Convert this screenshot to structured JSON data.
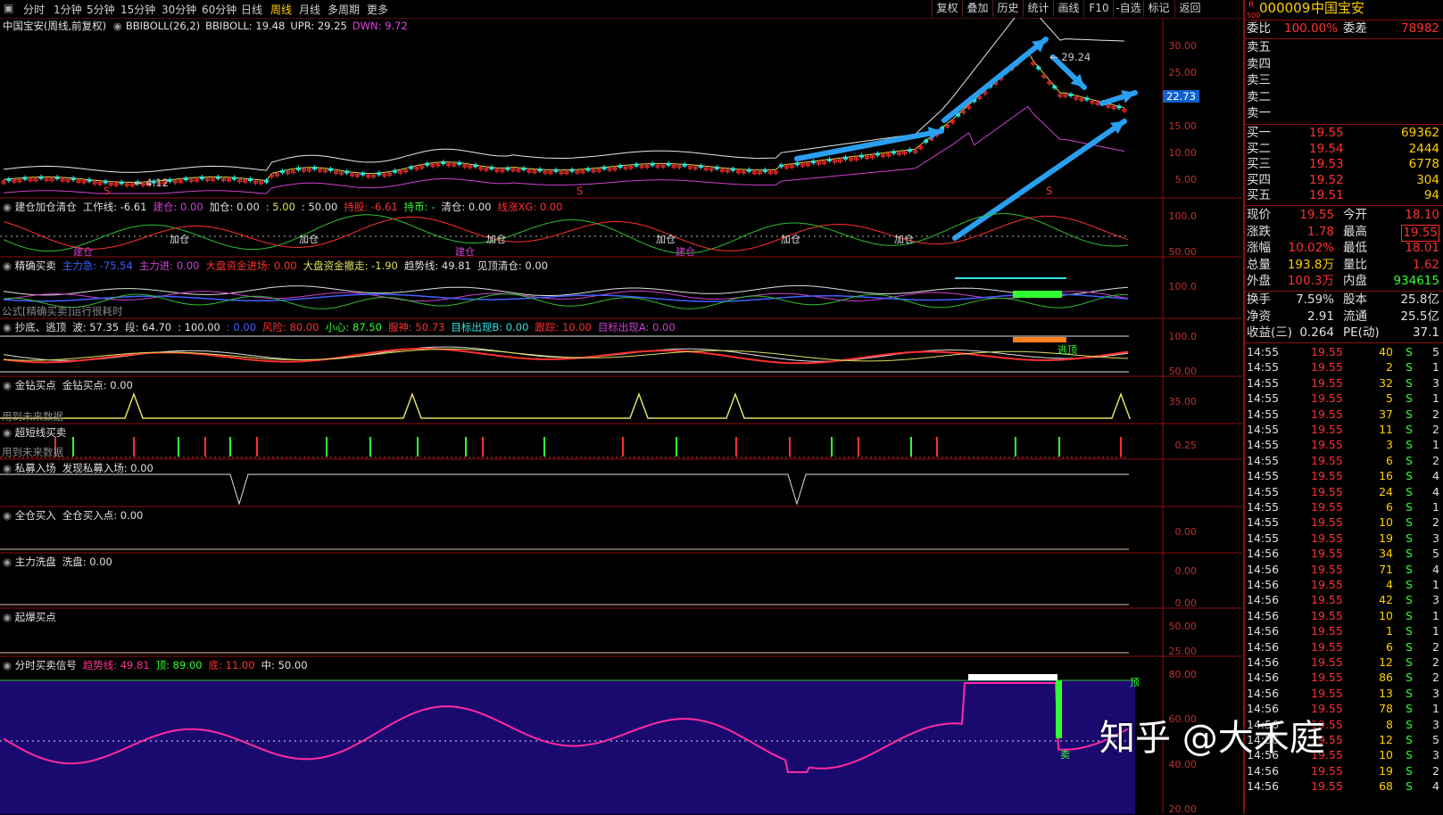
{
  "toolbar": {
    "tabs": [
      "分时",
      "1分钟",
      "5分钟",
      "15分钟",
      "30分钟",
      "60分钟",
      "日线",
      "周线",
      "月线",
      "多周期",
      "更多"
    ],
    "active_tab": "周线",
    "right_buttons": [
      "复权",
      "叠加",
      "历史",
      "统计",
      "画线",
      "F10",
      "-自选",
      "标记",
      "返回"
    ]
  },
  "main_panel": {
    "title": "中国宝安(周线,前复权)",
    "indicator": "BBIBOLL(26,2)",
    "bbiboll": "BBIBOLL: 19.48",
    "upr": "UPR: 29.25",
    "dwn": "DWN: 9.72",
    "high_mark": "29.24",
    "low_mark": "4.12",
    "price_tag": "22.73",
    "axis": [
      "30.00",
      "25.00",
      "20.00",
      "15.00",
      "10.00",
      "5.00"
    ],
    "s_marks": [
      "S",
      "S",
      "S"
    ]
  },
  "panels": [
    {
      "title": "建仓加仓清仓",
      "items": [
        "工作线: -6.61",
        "建仓: 0.00",
        "加仓: 0.00",
        ": 5.00",
        ": 50.00",
        "持股: -6.61",
        "持币: -",
        "清仓: 0.00",
        "线涨XG: 0.00"
      ],
      "axis": [
        "100.0",
        "50.00"
      ],
      "marks": [
        "建仓",
        "加仓",
        "加仓",
        "建仓",
        "加仓",
        "建仓",
        "加仓",
        "加仓",
        "加仓"
      ]
    },
    {
      "title": "精确买卖",
      "items": [
        "主力急: -75.54",
        "主力进: 0.00",
        "大盘资金进场: 0.00",
        "大盘资金撤走: -1.90",
        "趋势线: 49.81",
        "见顶清仓: 0.00"
      ],
      "axis": [
        "100.0"
      ],
      "note": "公式[精确买卖]运行很耗时"
    },
    {
      "title": "抄底、逃顶",
      "items": [
        "波: 57.35",
        "段: 64.70",
        ": 100.00",
        ": 0.00",
        "风险: 80.00",
        "小心: 87.50",
        "服神: 50.73",
        "目标出现B: 0.00",
        "跟踪: 10.00",
        "目标出现A: 0.00"
      ],
      "axis": [
        "100.0",
        "50.00"
      ],
      "mark": "逃顶"
    },
    {
      "title": "金钻买点",
      "items": [
        "金钻买点: 0.00"
      ],
      "axis": [
        "35.00"
      ],
      "note": "用到未来数据"
    },
    {
      "title": "超短线买卖",
      "items": [],
      "axis": [
        "0.25"
      ],
      "note": "用到未来数据"
    },
    {
      "title": "私募入场",
      "items": [
        "发现私募入场: 0.00"
      ],
      "axis": []
    },
    {
      "title": "全仓买入",
      "items": [
        "全仓买入点: 0.00"
      ],
      "axis": [
        "0.00"
      ]
    },
    {
      "title": "主力洗盘",
      "items": [
        "洗盘: 0.00"
      ],
      "axis": [
        "0.00",
        "0.00"
      ]
    },
    {
      "title": "起爆买点",
      "items": [],
      "axis": [
        "50.00",
        "25.00"
      ]
    },
    {
      "title": "分时买卖信号",
      "items": [
        "趋势线: 49.81",
        "顶: 89.00",
        "底: 11.00",
        "中: 50.00"
      ],
      "axis": [
        "80.00",
        "60.00",
        "40.00",
        "20.00"
      ],
      "marks": [
        "顶",
        "卖"
      ]
    }
  ],
  "quote": {
    "code": "000009",
    "name": "中国宝安",
    "r_label": "R",
    "r_num": "500",
    "weibi_label": "委比",
    "weibi": "100.00%",
    "weicha_label": "委差",
    "weicha": "78982",
    "asks": [
      "卖五",
      "卖四",
      "卖三",
      "卖二",
      "卖一"
    ],
    "bids": [
      {
        "label": "买一",
        "price": "19.55",
        "vol": "69362"
      },
      {
        "label": "买二",
        "price": "19.54",
        "vol": "2444"
      },
      {
        "label": "买三",
        "price": "19.53",
        "vol": "6778"
      },
      {
        "label": "买四",
        "price": "19.52",
        "vol": "304"
      },
      {
        "label": "买五",
        "price": "19.51",
        "vol": "94"
      }
    ],
    "stats": [
      {
        "l1": "现价",
        "v1": "19.55",
        "l2": "今开",
        "v2": "18.10"
      },
      {
        "l1": "涨跌",
        "v1": "1.78",
        "l2": "最高",
        "v2": "19.55"
      },
      {
        "l1": "涨幅",
        "v1": "10.02%",
        "l2": "最低",
        "v2": "18.01"
      },
      {
        "l1": "总量",
        "v1": "193.8万",
        "l2": "量比",
        "v2": "1.62"
      },
      {
        "l1": "外盘",
        "v1": "100.3万",
        "l2": "内盘",
        "v2": "934615"
      }
    ],
    "stats2": [
      {
        "l1": "换手",
        "v1": "7.59%",
        "l2": "股本",
        "v2": "25.8亿"
      },
      {
        "l1": "净资",
        "v1": "2.91",
        "l2": "流通",
        "v2": "25.5亿"
      },
      {
        "l1": "收益(三)",
        "v1": "0.264",
        "l2": "PE(动)",
        "v2": "37.1"
      }
    ],
    "ticks": [
      [
        "14:55",
        "19.55",
        "40",
        "S",
        "5"
      ],
      [
        "14:55",
        "19.55",
        "2",
        "S",
        "1"
      ],
      [
        "14:55",
        "19.55",
        "32",
        "S",
        "3"
      ],
      [
        "14:55",
        "19.55",
        "5",
        "S",
        "1"
      ],
      [
        "14:55",
        "19.55",
        "37",
        "S",
        "2"
      ],
      [
        "14:55",
        "19.55",
        "11",
        "S",
        "2"
      ],
      [
        "14:55",
        "19.55",
        "3",
        "S",
        "1"
      ],
      [
        "14:55",
        "19.55",
        "6",
        "S",
        "2"
      ],
      [
        "14:55",
        "19.55",
        "16",
        "S",
        "4"
      ],
      [
        "14:55",
        "19.55",
        "24",
        "S",
        "4"
      ],
      [
        "14:55",
        "19.55",
        "6",
        "S",
        "1"
      ],
      [
        "14:55",
        "19.55",
        "10",
        "S",
        "2"
      ],
      [
        "14:55",
        "19.55",
        "19",
        "S",
        "3"
      ],
      [
        "14:56",
        "19.55",
        "34",
        "S",
        "5"
      ],
      [
        "14:56",
        "19.55",
        "71",
        "S",
        "4"
      ],
      [
        "14:56",
        "19.55",
        "4",
        "S",
        "1"
      ],
      [
        "14:56",
        "19.55",
        "42",
        "S",
        "3"
      ],
      [
        "14:56",
        "19.55",
        "10",
        "S",
        "1"
      ],
      [
        "14:56",
        "19.55",
        "1",
        "S",
        "1"
      ],
      [
        "14:56",
        "19.55",
        "6",
        "S",
        "2"
      ],
      [
        "14:56",
        "19.55",
        "12",
        "S",
        "2"
      ],
      [
        "14:56",
        "19.55",
        "86",
        "S",
        "2"
      ],
      [
        "14:56",
        "19.55",
        "13",
        "S",
        "3"
      ],
      [
        "14:56",
        "19.55",
        "78",
        "S",
        "1"
      ],
      [
        "14:56",
        "19.55",
        "8",
        "S",
        "3"
      ],
      [
        "14:56",
        "19.55",
        "12",
        "S",
        "5"
      ],
      [
        "14:56",
        "19.55",
        "10",
        "S",
        "3"
      ],
      [
        "14:56",
        "19.55",
        "19",
        "S",
        "2"
      ],
      [
        "14:56",
        "19.55",
        "68",
        "S",
        "4"
      ]
    ]
  },
  "watermark": "知乎 @大禾庭"
}
